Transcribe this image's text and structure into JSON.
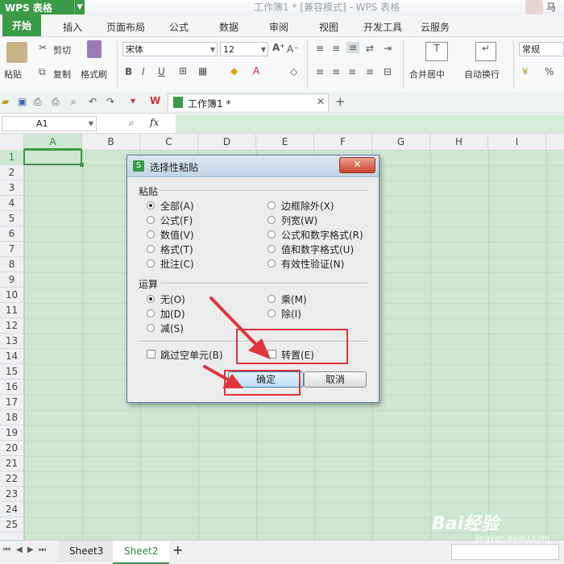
{
  "title_bar": {
    "app_button": "WPS 表格",
    "doc_title": "工作簿1 * [兼容模式] - WPS 表格",
    "user": "马"
  },
  "menu": {
    "tabs": [
      "开始",
      "插入",
      "页面布局",
      "公式",
      "数据",
      "审阅",
      "视图",
      "开发工具",
      "云服务"
    ],
    "active": "开始"
  },
  "ribbon": {
    "paste": "粘贴",
    "cut": "剪切",
    "copy": "复制",
    "format_painter": "格式刷",
    "font_name": "宋体",
    "font_size": "12",
    "merge_center": "合并居中",
    "wrap_text": "自动换行",
    "number_format": "常规"
  },
  "doc_tab": {
    "label": "工作簿1 *"
  },
  "formula_bar": {
    "name_box": "A1",
    "fx": "fx"
  },
  "grid": {
    "columns": [
      "A",
      "B",
      "C",
      "D",
      "E",
      "F",
      "G",
      "H",
      "I"
    ],
    "rows": [
      "1",
      "2",
      "3",
      "4",
      "5",
      "6",
      "7",
      "8",
      "9",
      "10",
      "11",
      "12",
      "13",
      "14",
      "15",
      "16",
      "17",
      "18",
      "19",
      "20",
      "21",
      "22",
      "23",
      "24",
      "25"
    ]
  },
  "sheets": {
    "tabs": [
      "Sheet3",
      "Sheet2"
    ],
    "active": "Sheet2",
    "add": "+"
  },
  "dialog": {
    "title": "选择性粘贴",
    "paste_group": "粘贴",
    "paste_options_left": [
      "全部(A)",
      "公式(F)",
      "数值(V)",
      "格式(T)",
      "批注(C)"
    ],
    "paste_options_right": [
      "边框除外(X)",
      "列宽(W)",
      "公式和数字格式(R)",
      "值和数字格式(U)",
      "有效性验证(N)"
    ],
    "operation_group": "运算",
    "operation_left": [
      "无(O)",
      "加(D)",
      "减(S)"
    ],
    "operation_right": [
      "乘(M)",
      "除(I)"
    ],
    "skip_blanks": "跳过空单元(B)",
    "transpose": "转置(E)",
    "ok": "确定",
    "cancel": "取消"
  },
  "watermark": {
    "brand": "Bai经验",
    "url": "jingyan.baidu.com"
  },
  "colors": {
    "accent": "#3a9a47",
    "grid": "#cfe6d1",
    "annotation": "#e0353b"
  }
}
